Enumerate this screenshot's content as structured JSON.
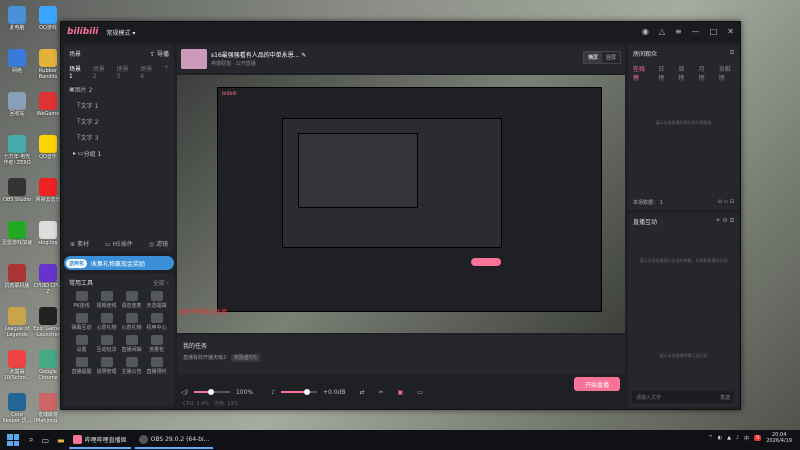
{
  "desktop": {
    "icons": [
      {
        "label": "此电脑",
        "color": "#4a90d9"
      },
      {
        "label": "QQ游戏",
        "color": "#3aa6ff"
      },
      {
        "label": "网络",
        "color": "#3a7ad9"
      },
      {
        "label": "Rubber Bandits",
        "color": "#e2b23a"
      },
      {
        "label": "回收站",
        "color": "#8aa0b8"
      },
      {
        "label": "WeGame",
        "color": "#d33"
      },
      {
        "label": "七万年·电光作者! ZERO",
        "color": "#4aa"
      },
      {
        "label": "QQ音乐",
        "color": "#ffd400"
      },
      {
        "label": "OBS Studio",
        "color": "#333"
      },
      {
        "label": "网易云音乐",
        "color": "#e22"
      },
      {
        "label": "迅雷游戏加速",
        "color": "#2a2"
      },
      {
        "label": "slog.log",
        "color": "#ddd"
      },
      {
        "label": "饥荒联机版",
        "color": "#a33"
      },
      {
        "label": "CPUID CPU-Z",
        "color": "#63c"
      },
      {
        "label": "League of Legends",
        "color": "#c9a44a"
      },
      {
        "label": "Epic Games Launcher",
        "color": "#222"
      },
      {
        "label": "大富翁10(Schm...",
        "color": "#e44"
      },
      {
        "label": "Google Chrome",
        "color": "#4a8"
      },
      {
        "label": "Core Keeper 饥...",
        "color": "#269"
      },
      {
        "label": "雀魂麻将 (Mahjong...",
        "color": "#c66"
      }
    ]
  },
  "app": {
    "logo": "bilibili",
    "mode": "常规模式",
    "mode_caret": "▾",
    "window_controls": [
      "◉",
      "△",
      "≡",
      "—",
      "□",
      "✕"
    ]
  },
  "scenes": {
    "title": "场景",
    "import_label": "导播",
    "tabs": [
      "场景1",
      "场景2",
      "场景3",
      "场景4",
      "场景5"
    ],
    "add": "+",
    "scene_name": "图片 2",
    "sources": [
      {
        "label": "文字 1"
      },
      {
        "label": "文字 2"
      },
      {
        "label": "文字 3"
      }
    ],
    "group": "分组 1",
    "bottom": [
      "素材",
      "H5插件",
      "滤镜"
    ]
  },
  "banner": {
    "badge": "送两包",
    "text": "收集礼物赢现金奖励"
  },
  "tools": {
    "title": "常用工具",
    "more": "全部 ›",
    "items": [
      "PK连线",
      "视频连线",
      "语音连麦",
      "天选福袋",
      "弹幕互动",
      "心愿礼物",
      "心愿礼物",
      "机甲中心",
      "设置",
      "互动玩法",
      "直播间抽",
      "流量包",
      "直播提醒",
      "说明管理",
      "主播公告",
      "直播预约"
    ]
  },
  "stream": {
    "title": "s16最强强看有人品的中单永恩...",
    "category": "英雄联盟",
    "visibility": "公开直播",
    "btn_h": "横屏",
    "btn_v": "竖屏"
  },
  "preview": {
    "overlay_text": "首先开场私信主播",
    "inner_title": "s16最强强看有人品的中单永恩..."
  },
  "task": {
    "title": "我的任务",
    "desc": "直播有效开播天级2",
    "reward": "奖励金5元"
  },
  "controls": {
    "volume": "100%",
    "mic": "+0.0dB",
    "golive": "开始直播"
  },
  "status": {
    "cpu": "CPU: 1.4%",
    "mem": "内存: 13%"
  },
  "audience": {
    "title": "房间观众",
    "tabs": [
      "在线榜",
      "日榜",
      "周榜",
      "月榜",
      "贡献榜"
    ],
    "empty": "展示本场直播的观众排行榜数据",
    "count_label": "本场数据：",
    "count_val": "1"
  },
  "interaction": {
    "title": "直播互动",
    "empty1": "展示本场直播观众发送的弹幕、礼物和直播间互动",
    "empty2": "展示本场直播弹幕互动记录",
    "input": "请输入文字",
    "send": "发送"
  },
  "taskbar": {
    "apps": [
      {
        "label": "哔哩哔哩直播姬"
      },
      {
        "label": "OBS 29.0.2 (64-bi..."
      }
    ],
    "time": "20:04",
    "date": "2026/4/19",
    "lang": "中",
    "sys_icons": [
      "^",
      "◐",
      "▲",
      "♪"
    ]
  }
}
